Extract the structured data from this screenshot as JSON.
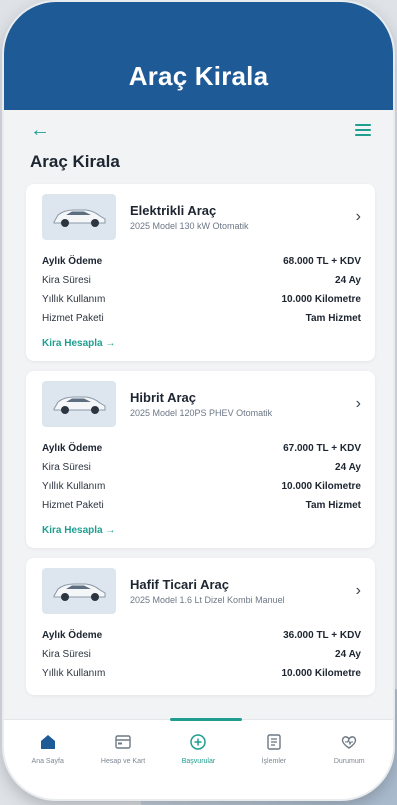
{
  "header": {
    "title": "Araç Kirala"
  },
  "page": {
    "title": "Araç Kirala"
  },
  "cards": [
    {
      "name": "Elektrikli Araç",
      "subtitle": "2025 Model 130 kW Otomatik",
      "rows": [
        {
          "label": "Aylık Ödeme",
          "value": "68.000 TL + KDV"
        },
        {
          "label": "Kira Süresi",
          "value": "24 Ay"
        },
        {
          "label": "Yıllık Kullanım",
          "value": "10.000 Kilometre"
        },
        {
          "label": "Hizmet Paketi",
          "value": "Tam Hizmet"
        }
      ],
      "link": "Kira Hesapla →"
    },
    {
      "name": "Hibrit Araç",
      "subtitle": "2025 Model 120PS PHEV Otomatik",
      "rows": [
        {
          "label": "Aylık Ödeme",
          "value": "67.000 TL + KDV"
        },
        {
          "label": "Kira Süresi",
          "value": "24 Ay"
        },
        {
          "label": "Yıllık Kullanım",
          "value": "10.000 Kilometre"
        },
        {
          "label": "Hizmet Paketi",
          "value": "Tam Hizmet"
        }
      ],
      "link": "Kira Hesapla →"
    },
    {
      "name": "Hafif Ticari Araç",
      "subtitle": "2025 Model 1.6 Lt Dizel Kombi Manuel",
      "rows": [
        {
          "label": "Aylık Ödeme",
          "value": "36.000 TL + KDV"
        },
        {
          "label": "Kira Süresi",
          "value": "24 Ay"
        },
        {
          "label": "Yıllık Kullanım",
          "value": "10.000 Kilometre"
        }
      ]
    }
  ],
  "bottom_nav": [
    {
      "label": "Ana Sayfa",
      "icon": "home-icon"
    },
    {
      "label": "Hesap ve Kart",
      "icon": "card-icon"
    },
    {
      "label": "Başvurular",
      "icon": "plus-circle-icon",
      "active": true
    },
    {
      "label": "İşlemler",
      "icon": "list-icon"
    },
    {
      "label": "Durumum",
      "icon": "heart-icon"
    }
  ],
  "colors": {
    "header": "#1e5a96",
    "accent": "#1f9e8f",
    "text": "#1c2530"
  }
}
